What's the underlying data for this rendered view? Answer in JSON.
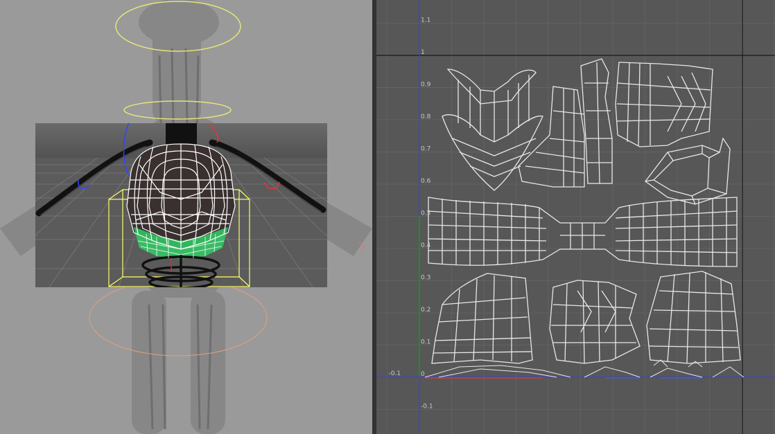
{
  "uv_editor": {
    "v_ticks": [
      {
        "label": "1.1",
        "v": 1.1
      },
      {
        "label": "1",
        "v": 1.0
      },
      {
        "label": "0.9",
        "v": 0.9
      },
      {
        "label": "0.8",
        "v": 0.8
      },
      {
        "label": "0.7",
        "v": 0.7
      },
      {
        "label": "0.6",
        "v": 0.6
      },
      {
        "label": "0.5",
        "v": 0.5
      },
      {
        "label": "0.4",
        "v": 0.4
      },
      {
        "label": "0.3",
        "v": 0.3
      },
      {
        "label": "0.2",
        "v": 0.2
      },
      {
        "label": "0.1",
        "v": 0.1
      },
      {
        "label": "0",
        "v": 0.0
      },
      {
        "label": "-0.1",
        "v": -0.1
      }
    ],
    "u_ticks": [
      {
        "label": "-0.1",
        "u": -0.1
      }
    ],
    "colors": {
      "background": "#575757",
      "grid": "#666666",
      "uv_shells": "#e8e8e8",
      "u_axis": "#3a3aff",
      "v_axis_positive": "#00aa00",
      "uv_border": "#1a1a1a"
    }
  },
  "viewport": {
    "colors": {
      "background": "#9a9a9a",
      "selection_box": "#ffff66",
      "wireframe": "#ffffff",
      "selected_faces": "#33cc66",
      "controller_yellow": "#e6e67a",
      "controller_orange": "#e0a080"
    }
  }
}
